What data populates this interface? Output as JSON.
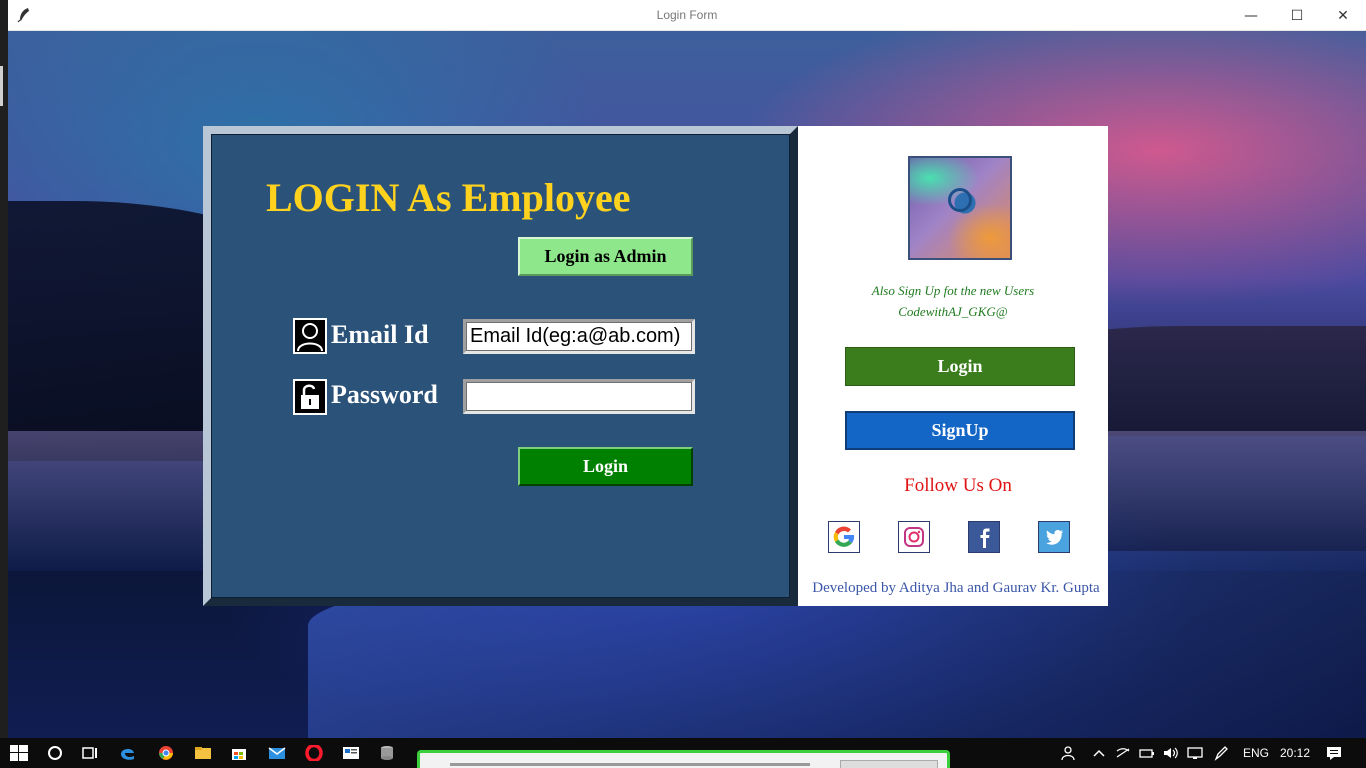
{
  "window": {
    "title": "Login Form",
    "controls": {
      "minimize": "—",
      "maximize": "☐",
      "close": "✕"
    }
  },
  "login_panel": {
    "heading": "LOGIN As Employee",
    "admin_button": "Login as Admin",
    "email_label": "Email Id",
    "email_value": "Email Id(eg:a@ab.com)",
    "password_label": "Password",
    "password_value": "",
    "login_button": "Login"
  },
  "side_panel": {
    "tagline_1": "Also Sign Up fot the new Users",
    "tagline_2": "CodewithAJ_GKG@",
    "login_button": "Login",
    "signup_button": "SignUp",
    "follow_text": "Follow Us On",
    "credits": "Developed by Aditya Jha and Gaurav Kr. Gupta",
    "social_icons": [
      "google-icon",
      "instagram-icon",
      "facebook-icon",
      "twitter-icon"
    ]
  },
  "taskbar": {
    "language": "ENG",
    "time": "20:12"
  },
  "colors": {
    "panel_blue": "#2b5279",
    "heading_yellow": "#ffd21e",
    "admin_green": "#8ee78b",
    "login_green": "#008000",
    "signup_blue": "#1466c6",
    "follow_red": "#e01212"
  }
}
